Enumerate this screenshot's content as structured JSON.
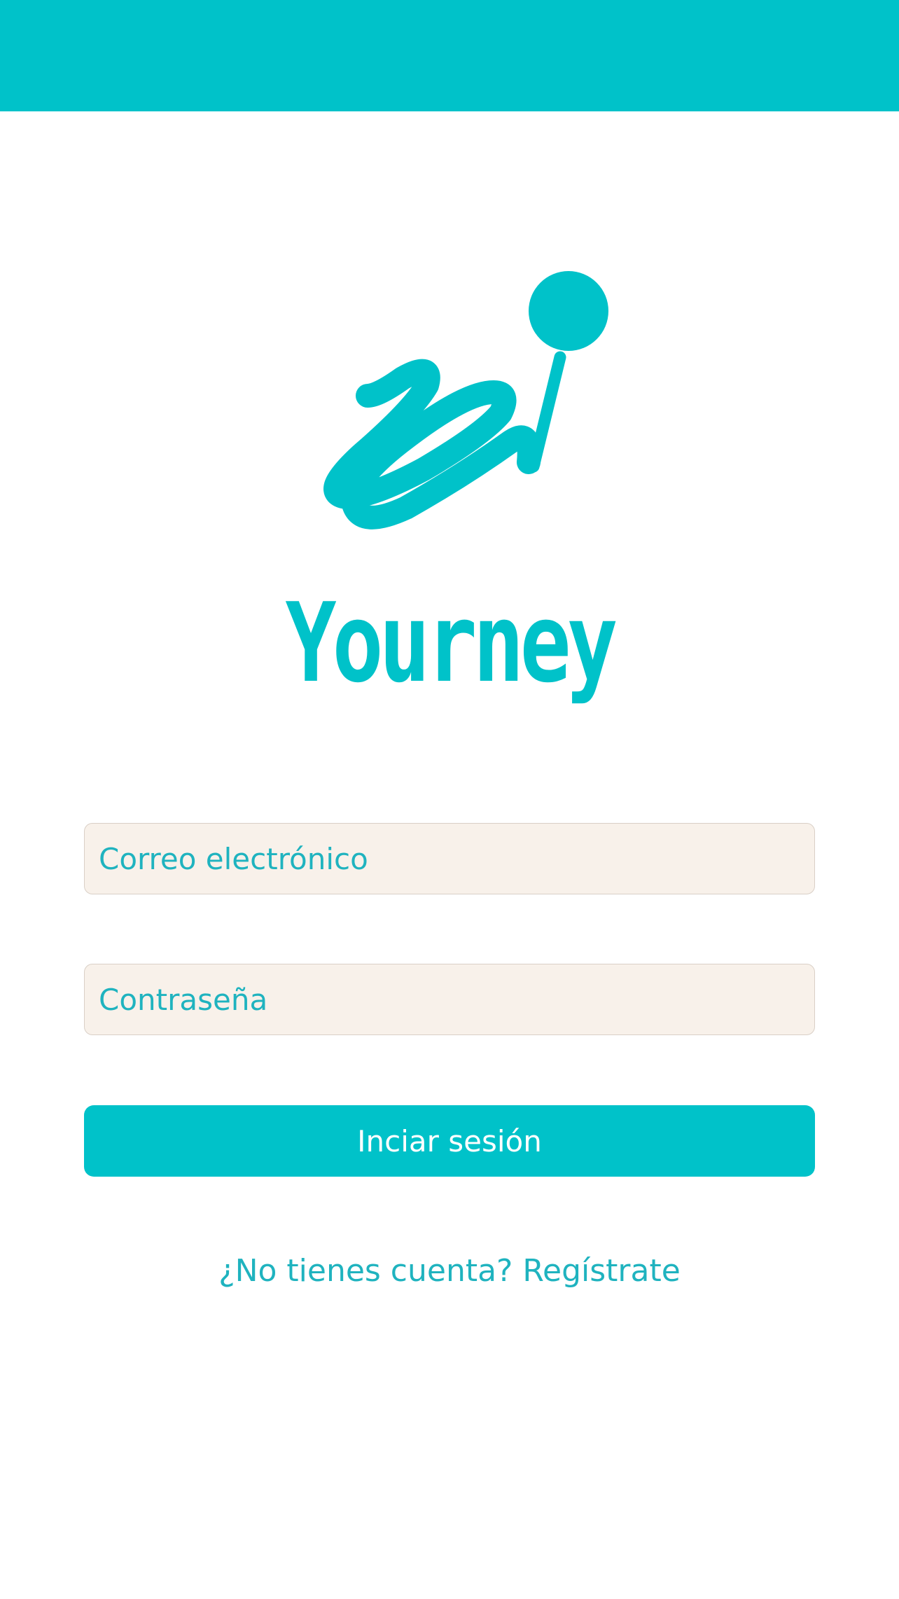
{
  "colors": {
    "brand": "#00c2c9",
    "field_background": "#f8f1ea",
    "button_text": "#ffffff"
  },
  "logo": {
    "icon": "journey-path-pin-icon",
    "wordmark": "Yourney"
  },
  "login_form": {
    "email_placeholder": "Correo electrónico",
    "password_placeholder": "Contraseña",
    "submit_label": "Inciar sesión"
  },
  "register_link": {
    "label": "¿No tienes cuenta? Regístrate"
  }
}
